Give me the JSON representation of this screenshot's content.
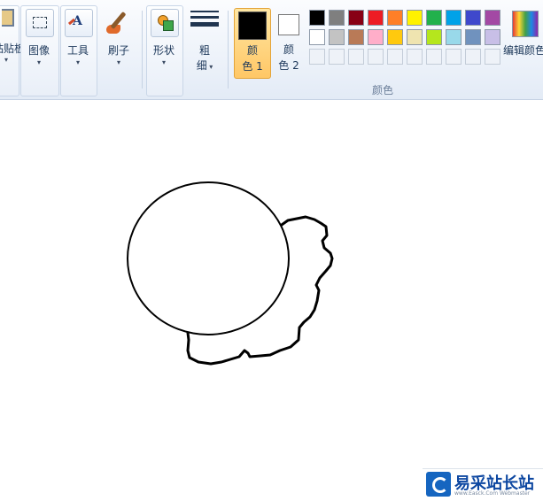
{
  "ribbon": {
    "clipboard_label": "粘贴板",
    "image_label": "图像",
    "tools_label": "工具",
    "brushes_label": "刷子",
    "shapes_label": "形状",
    "size_label_1": "粗",
    "size_label_2": "细",
    "color1_label_1": "颜",
    "color1_label_2": "色 1",
    "color2_label_1": "颜",
    "color2_label_2": "色 2",
    "colors_group_label": "颜色",
    "edit_colors_label": "编辑颜色"
  },
  "colors": {
    "color1": "#000000",
    "color2": "#ffffff",
    "palette_row1": [
      "#000000",
      "#7f7f7f",
      "#880015",
      "#ed1c24",
      "#ff7f27",
      "#fff200",
      "#22b14c",
      "#00a2e8",
      "#3f48cc",
      "#a349a4"
    ],
    "palette_row2": [
      "#ffffff",
      "#c3c3c3",
      "#b97a57",
      "#ffaec9",
      "#ffc90e",
      "#efe4b0",
      "#b5e61d",
      "#99d9ea",
      "#7092be",
      "#c8bfe7"
    ]
  },
  "watermark": {
    "text": "易采站长站",
    "subtext": "www.Easck.Com Webmaster"
  }
}
